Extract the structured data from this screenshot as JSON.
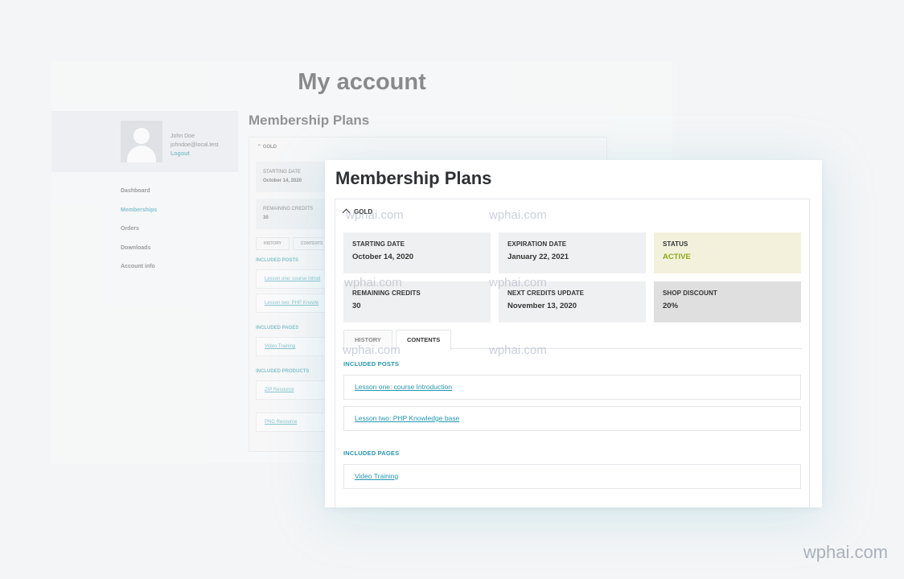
{
  "background_page": {
    "title": "My account",
    "user": {
      "name": "John Doe",
      "email": "johndoe@local.test",
      "logout_label": "Logout"
    },
    "nav": [
      {
        "label": "Dashboard",
        "active": false
      },
      {
        "label": "Memberships",
        "active": true
      },
      {
        "label": "Orders",
        "active": false
      },
      {
        "label": "Downloads",
        "active": false
      },
      {
        "label": "Account info",
        "active": false
      }
    ],
    "heading": "Membership Plans",
    "plan_name": "GOLD",
    "stats": [
      {
        "label": "STARTING DATE",
        "value": "October 14, 2020"
      },
      {
        "label": "REMAINING CREDITS",
        "value": "30"
      }
    ],
    "tabs": [
      "HISTORY",
      "CONTENTS"
    ],
    "sections": {
      "posts_label": "INCLUDED POSTS",
      "pages_label": "INCLUDED PAGES",
      "products_label": "INCLUDED PRODUCTS"
    },
    "posts": [
      "Lesson one: course Introd",
      "Lesson two: PHP Knowle"
    ],
    "pages": [
      "Video Training"
    ],
    "products": [
      "ZIP Resource",
      "PNG Resource"
    ]
  },
  "membership": {
    "heading": "Membership Plans",
    "plan_name": "GOLD",
    "stats": {
      "starting_date": {
        "label": "STARTING DATE",
        "value": "October 14, 2020"
      },
      "expiration_date": {
        "label": "EXPIRATION DATE",
        "value": "January 22, 2021"
      },
      "status": {
        "label": "STATUS",
        "value": "ACTIVE"
      },
      "remaining_credits": {
        "label": "REMAINING CREDITS",
        "value": "30"
      },
      "next_credits_update": {
        "label": "NEXT CREDITS UPDATE",
        "value": "November 13, 2020"
      },
      "shop_discount": {
        "label": "SHOP DISCOUNT",
        "value": "20%"
      }
    },
    "tabs": {
      "history": "HISTORY",
      "contents": "CONTENTS",
      "active": "contents"
    },
    "included_posts_label": "INCLUDED POSTS",
    "posts": [
      "Lesson one: course Introduction",
      "Lesson two: PHP Knowledge base"
    ],
    "included_pages_label": "INCLUDED PAGES",
    "pages": [
      "Video Training"
    ]
  },
  "colors": {
    "accent": "#2597b0",
    "status_active": "#8da812",
    "status_bg": "#f3f1dc",
    "discount_bg": "#dfdfdf"
  },
  "icons": {
    "plan_toggle": "chevron-up-icon",
    "avatar": "user-avatar-placeholder"
  },
  "watermark": "wphai.com"
}
